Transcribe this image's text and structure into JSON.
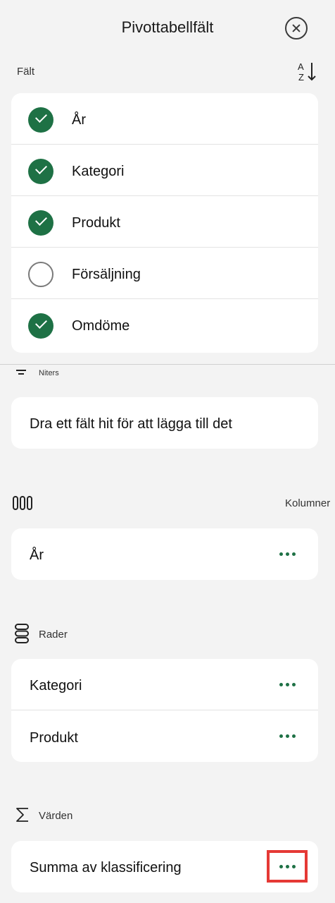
{
  "header": {
    "title": "Pivottabellfält"
  },
  "fields": {
    "label": "Fält",
    "items": [
      {
        "label": "År",
        "checked": true
      },
      {
        "label": "Kategori",
        "checked": true
      },
      {
        "label": "Produkt",
        "checked": true
      },
      {
        "label": "Försäljning",
        "checked": false
      },
      {
        "label": "Omdöme",
        "checked": true
      }
    ]
  },
  "filters": {
    "label": "Niters",
    "placeholder": "Dra ett fält hit för att lägga till det"
  },
  "columns": {
    "label": "Kolumner",
    "items": [
      {
        "label": "År"
      }
    ]
  },
  "rows": {
    "label": "Rader",
    "items": [
      {
        "label": "Kategori"
      },
      {
        "label": "Produkt"
      }
    ]
  },
  "values": {
    "label": "Värden",
    "items": [
      {
        "label": "Summa av klassificering"
      }
    ]
  },
  "colors": {
    "accent": "#1e7145",
    "highlight": "#e53935"
  }
}
